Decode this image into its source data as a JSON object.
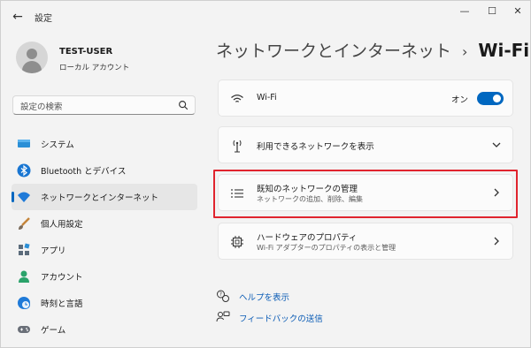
{
  "app": {
    "title": "設定",
    "back_icon": "back-arrow-icon",
    "window_controls": [
      "minimize-icon",
      "maximize-icon",
      "close-icon"
    ]
  },
  "user": {
    "name": "TEST-USER",
    "account_type": "ローカル アカウント"
  },
  "search": {
    "placeholder": "設定の検索",
    "icon": "search-icon"
  },
  "sidebar": {
    "items": [
      {
        "label": "システム",
        "icon": "system-monitor-icon",
        "selected": false
      },
      {
        "label": "Bluetooth とデバイス",
        "icon": "bluetooth-icon",
        "selected": false
      },
      {
        "label": "ネットワークとインターネット",
        "icon": "wifi-icon",
        "selected": true
      },
      {
        "label": "個人用設定",
        "icon": "brush-icon",
        "selected": false
      },
      {
        "label": "アプリ",
        "icon": "apps-icon",
        "selected": false
      },
      {
        "label": "アカウント",
        "icon": "account-icon",
        "selected": false
      },
      {
        "label": "時刻と言語",
        "icon": "clock-globe-icon",
        "selected": false
      },
      {
        "label": "ゲーム",
        "icon": "gamepad-icon",
        "selected": false
      }
    ]
  },
  "breadcrumb": {
    "parent": "ネットワークとインターネット",
    "separator": "›",
    "current": "Wi-Fi"
  },
  "cards": [
    {
      "title": "Wi-Fi",
      "icon": "wifi-icon",
      "toggle_label": "オン",
      "toggle_on": true
    },
    {
      "title": "利用できるネットワークを表示",
      "icon": "antenna-icon",
      "chevron": "chevron-down-icon"
    },
    {
      "title": "既知のネットワークの管理",
      "subtitle": "ネットワークの追加、削除、編集",
      "icon": "list-icon",
      "chevron": "chevron-right-icon",
      "highlighted": true
    },
    {
      "title": "ハードウェアのプロパティ",
      "subtitle": "Wi-Fi アダプターのプロパティの表示と管理",
      "icon": "chip-icon",
      "chevron": "chevron-right-icon"
    }
  ],
  "links": [
    {
      "label": "ヘルプを表示",
      "icon": "help-icon"
    },
    {
      "label": "フィードバックの送信",
      "icon": "feedback-icon"
    }
  ],
  "colors": {
    "accent": "#0067c0",
    "highlight_border": "#e0242e",
    "background": "#f3f3f3",
    "card": "#fbfbfb"
  }
}
